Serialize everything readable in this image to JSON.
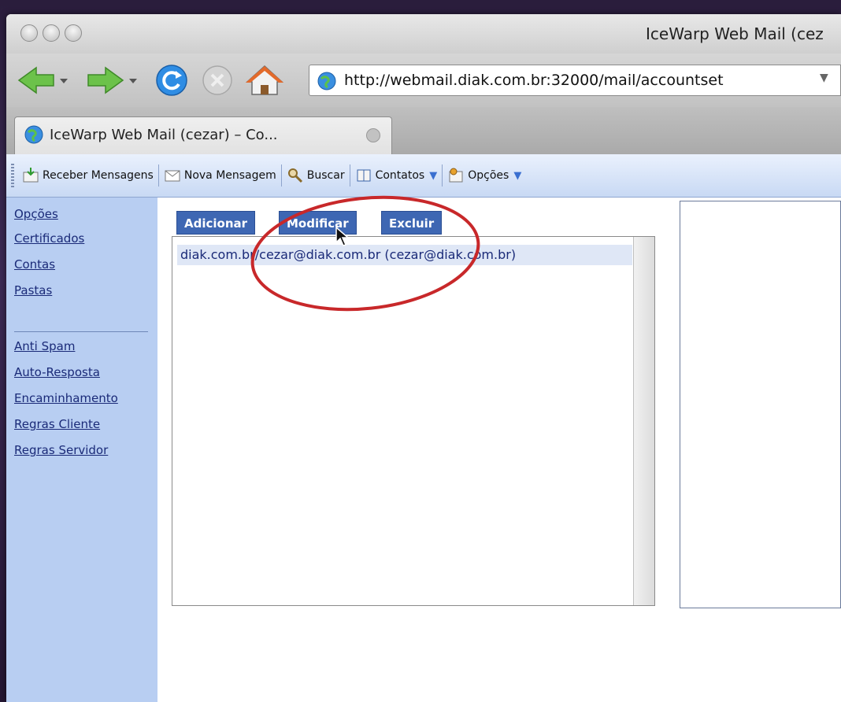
{
  "window": {
    "title": "IceWarp Web Mail (cez"
  },
  "browser": {
    "url": "http://webmail.diak.com.br:32000/mail/accountset",
    "tab_label": "IceWarp Web Mail (cezar) – Co...",
    "icons": [
      "back-arrow-icon",
      "forward-arrow-icon",
      "reload-icon",
      "stop-icon",
      "home-icon",
      "globe-icon"
    ]
  },
  "toolbar": {
    "receive_label": "Receber Mensagens",
    "new_message_label": "Nova Mensagem",
    "search_label": "Buscar",
    "contacts_label": "Contatos",
    "options_label": "Opções"
  },
  "sidebar": {
    "items": [
      {
        "label": "Opções"
      },
      {
        "label": "Certificados"
      },
      {
        "label": "Contas"
      },
      {
        "label": "Pastas"
      },
      {
        "label": "Anti Spam"
      },
      {
        "label": "Auto-Resposta"
      },
      {
        "label": "Encaminhamento"
      },
      {
        "label": "Regras Cliente"
      },
      {
        "label": "Regras Servidor"
      }
    ]
  },
  "main": {
    "add_label": "Adicionar",
    "modify_label": "Modificar",
    "delete_label": "Excluir",
    "accounts": [
      {
        "label": "diak.com.br/cezar@diak.com.br (cezar@diak.com.br)"
      }
    ]
  },
  "colors": {
    "sidebar_bg": "#b8cef2",
    "button_bg": "#3e67b3",
    "link_color": "#1a2a78",
    "annotation_red": "#c8282a"
  }
}
